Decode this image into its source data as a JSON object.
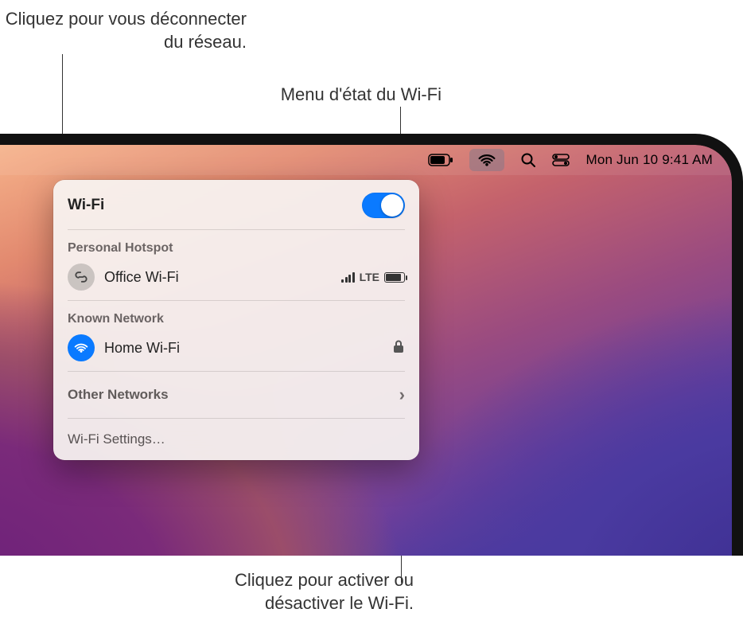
{
  "callouts": {
    "disconnect": "Cliquez pour vous déconnecter du réseau.",
    "status_menu": "Menu d'état du Wi-Fi",
    "toggle": "Cliquez pour activer ou désactiver le Wi-Fi."
  },
  "menubar": {
    "datetime": "Mon Jun 10  9:41 AM"
  },
  "panel": {
    "title": "Wi-Fi",
    "toggle_on": true,
    "personal_hotspot_label": "Personal Hotspot",
    "hotspot": {
      "name": "Office Wi-Fi",
      "carrier": "LTE"
    },
    "known_network_label": "Known Network",
    "known": {
      "name": "Home Wi-Fi",
      "secured": true
    },
    "other_networks_label": "Other Networks",
    "settings_label": "Wi-Fi Settings…"
  }
}
